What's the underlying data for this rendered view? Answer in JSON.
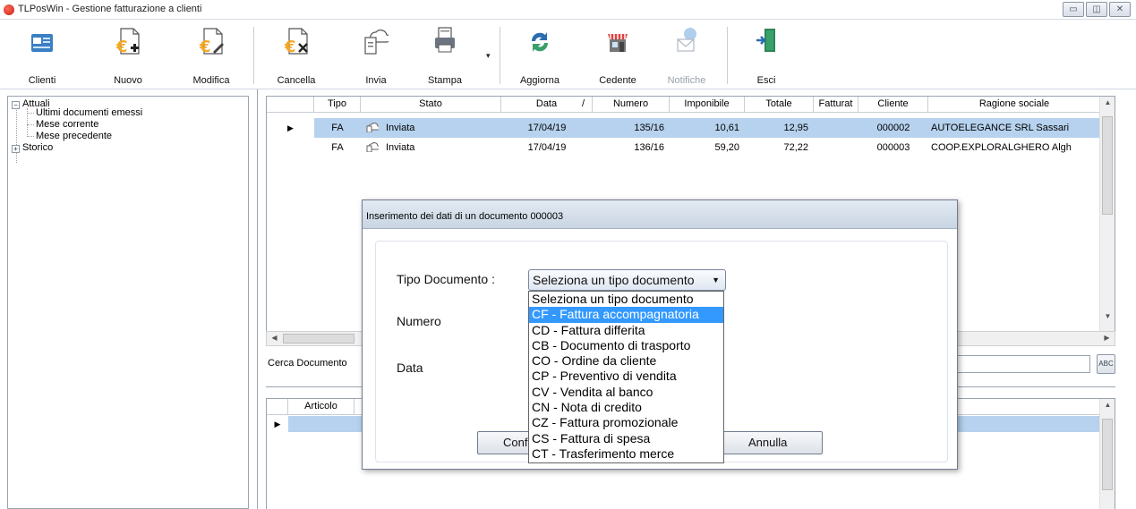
{
  "window": {
    "title": "TLPosWin - Gestione fatturazione a clienti",
    "controls": [
      "▭",
      "◫",
      "✕"
    ]
  },
  "toolbar": {
    "buttons": [
      {
        "label": "Clienti",
        "icon": "clients-card-icon"
      },
      {
        "label": "Nuovo",
        "icon": "new-invoice-icon"
      },
      {
        "label": "Modifica",
        "icon": "edit-invoice-icon"
      },
      {
        "label": "Cancella",
        "icon": "delete-invoice-icon"
      },
      {
        "label": "Invia",
        "icon": "cloud-send-icon"
      },
      {
        "label": "Stampa",
        "icon": "printer-icon"
      },
      {
        "label": "Aggiorna",
        "icon": "refresh-icon"
      },
      {
        "label": "Cedente",
        "icon": "store-icon"
      },
      {
        "label": "Notifiche",
        "icon": "notification-mail-icon",
        "disabled": true
      },
      {
        "label": "Esci",
        "icon": "exit-door-icon"
      }
    ],
    "stampa_arrow": "▾"
  },
  "tree": {
    "attuali": "Attuali",
    "ultimi": "Ultimi documenti emessi",
    "mese_corrente": "Mese corrente",
    "mese_precedente": "Mese precedente",
    "storico": "Storico"
  },
  "grid": {
    "columns": [
      "Tipo",
      "Stato",
      "Data",
      "Numero",
      "Imponibile",
      "Totale",
      "Fatturat",
      "Cliente",
      "Ragione sociale"
    ],
    "rows": [
      {
        "tipo": "FA",
        "stato": "Inviata",
        "data": "17/04/19",
        "numero": "135/16",
        "imponibile": "10,61",
        "totale": "12,95",
        "fatturato": "",
        "cliente": "000002",
        "ragione": "AUTOELEGANCE SRL Sassari",
        "selected": true
      },
      {
        "tipo": "FA",
        "stato": "Inviata",
        "data": "17/04/19",
        "numero": "136/16",
        "imponibile": "59,20",
        "totale": "72,22",
        "fatturato": "",
        "cliente": "000003",
        "ragione": "COOP.EXPLORALGHERO Algh",
        "selected": false
      }
    ],
    "row_marker": "▶",
    "sort_marker": "/"
  },
  "search": {
    "label": "Cerca Documento",
    "value": "",
    "button_text": "ABC"
  },
  "grid2": {
    "columns": [
      "Articolo"
    ],
    "row_marker": "▶"
  },
  "dialog": {
    "title": "Inserimento dei dati di un documento 000003",
    "label_tipo": "Tipo Documento :",
    "label_numero": "Numero",
    "label_data": "Data",
    "combo_value": "Seleziona un tipo documento",
    "options": [
      "Seleziona un tipo documento",
      "CF - Fattura accompagnatoria",
      "CD - Fattura differita",
      "CB - Documento di trasporto",
      "CO - Ordine da cliente",
      "CP - Preventivo di vendita",
      "CV - Vendita al banco",
      "CN - Nota di credito",
      "CZ - Fattura promozionale",
      "CS - Fattura di spesa",
      "CT - Trasferimento merce"
    ],
    "highlighted_option": 1,
    "confirm_label": "Conf",
    "cancel_label": "Annulla"
  },
  "colors": {
    "selection": "#b6d2ee",
    "highlight": "#3399ff",
    "euro": "#f5a623",
    "accent_blue": "#2b6cb0"
  }
}
